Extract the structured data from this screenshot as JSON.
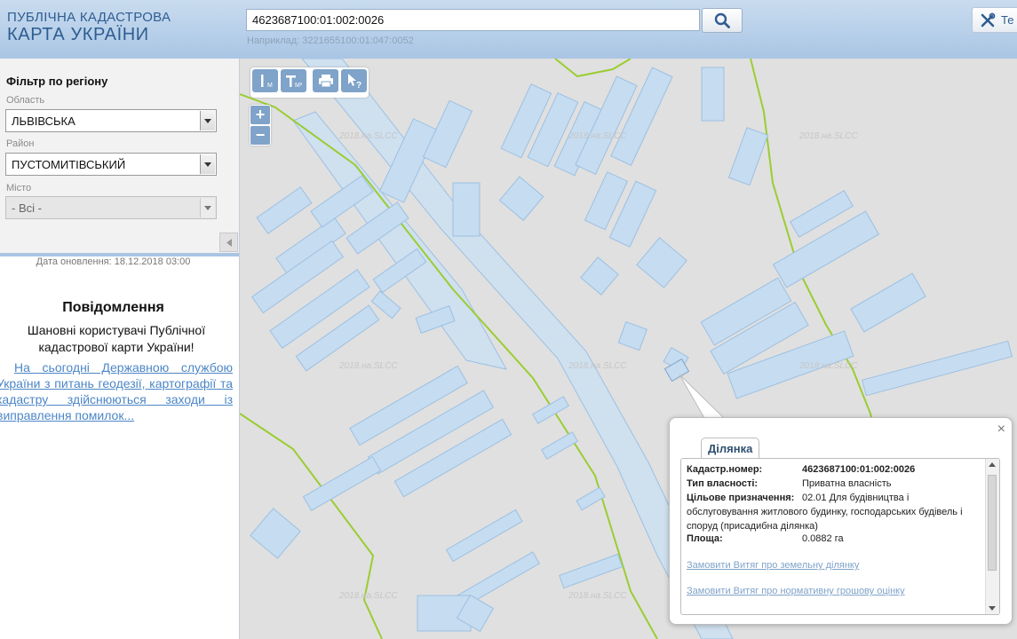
{
  "header": {
    "logo_line1": "ПУБЛІЧНА КАДАСТРОВА",
    "logo_line2": "КАРТА УКРАЇНИ",
    "search_value": "4623687100:01:002:0026",
    "search_hint": "Наприклад: 3221655100:01:047:0052",
    "search_icon": "search-icon",
    "tools_label": "Те",
    "tools_icon": "tools-icon"
  },
  "sidebar": {
    "filter_title": "Фільтр по регіону",
    "region_label": "Область",
    "region_value": "ЛЬВІВСЬКА",
    "district_label": "Район",
    "district_value": "ПУСТОМИТІВСЬКИЙ",
    "city_label": "Місто",
    "city_value": "- Всі -",
    "update_date": "Дата оновлення: 18.12.2018 03:00",
    "notice_title": "Повідомлення",
    "notice_text": "Шановні користувачі Публічної кадастрової карти України!",
    "notice_link": "На сьогодні Державною службою України з питань геодезії, картографії та кадастру здійснюються заходи із виправлення помилок..."
  },
  "map": {
    "watermark": "2018.нa.SLCC",
    "toolbar": {
      "ruler_label": "М",
      "area_label": "М²",
      "print_icon": "print-icon",
      "identify_icon": "identify-cursor-icon"
    },
    "zoom_in": "+",
    "zoom_out": "−",
    "colors": {
      "parcel_fill": "#c6dcf0",
      "parcel_stroke": "#9cc0e2",
      "boundary": "#9acd32",
      "background": "#e0e0e0"
    }
  },
  "popup": {
    "tab_label": "Ділянка",
    "close_label": "×",
    "rows": [
      {
        "key": "Кадастр.номер:",
        "value": "4623687100:01:002:0026"
      },
      {
        "key": "Тип власності:",
        "value": "Приватна власність"
      },
      {
        "key": "Цільове призначення:",
        "value": "02.01 Для будівництва і"
      },
      {
        "key": "",
        "value": "обслуговування житлового будинку, господарських будівель і"
      },
      {
        "key": "",
        "value": "споруд (присадибна ділянка)"
      },
      {
        "key": "Площа:",
        "value": "0.0882 га"
      }
    ],
    "link1": "Замовити Витяг про земельну ділянку",
    "link2": "Замовити Витяг про нормативну грошову оцінку"
  }
}
